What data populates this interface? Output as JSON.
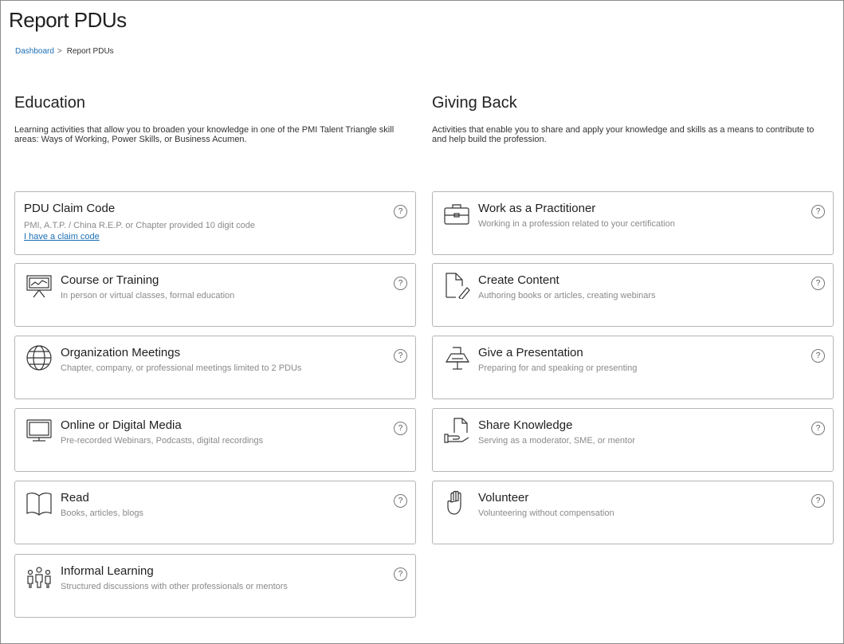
{
  "page": {
    "title": "Report PDUs"
  },
  "breadcrumb": {
    "home": "Dashboard",
    "separator": ">",
    "current": "Report PDUs"
  },
  "education": {
    "title": "Education",
    "description": "Learning activities that allow you to broaden your knowledge in one of the PMI Talent Triangle skill areas: Ways of Working, Power Skills, or Business Acumen.",
    "cards": [
      {
        "title": "PDU Claim Code",
        "desc": "PMI, A.T.P. / China R.E.P. or Chapter provided 10 digit code",
        "link": "I have a claim code",
        "icon": "none"
      },
      {
        "title": "Course or Training",
        "desc": "In person or virtual classes, formal education",
        "icon": "easel-chart-icon"
      },
      {
        "title": "Organization Meetings",
        "desc": "Chapter, company, or professional meetings limited to 2 PDUs",
        "icon": "globe-icon"
      },
      {
        "title": "Online or Digital Media",
        "desc": "Pre-recorded Webinars, Podcasts, digital recordings",
        "icon": "monitor-icon"
      },
      {
        "title": "Read",
        "desc": "Books, articles, blogs",
        "icon": "open-book-icon"
      },
      {
        "title": "Informal Learning",
        "desc": "Structured discussions with other professionals or mentors",
        "icon": "people-group-icon"
      }
    ]
  },
  "giving_back": {
    "title": "Giving Back",
    "description": "Activities that enable you to share and apply your knowledge and skills as a means to contribute to and help build the profession.",
    "cards": [
      {
        "title": "Work as a Practitioner",
        "desc": "Working in a profession related to your certification",
        "icon": "briefcase-icon"
      },
      {
        "title": "Create Content",
        "desc": "Authoring books or articles, creating webinars",
        "icon": "document-pen-icon"
      },
      {
        "title": "Give a Presentation",
        "desc": "Preparing for and speaking or presenting",
        "icon": "podium-icon"
      },
      {
        "title": "Share Knowledge",
        "desc": "Serving as a moderator, SME, or mentor",
        "icon": "hand-document-icon"
      },
      {
        "title": "Volunteer",
        "desc": "Volunteering without compensation",
        "icon": "raised-hand-icon"
      }
    ]
  },
  "help_glyph": "?"
}
